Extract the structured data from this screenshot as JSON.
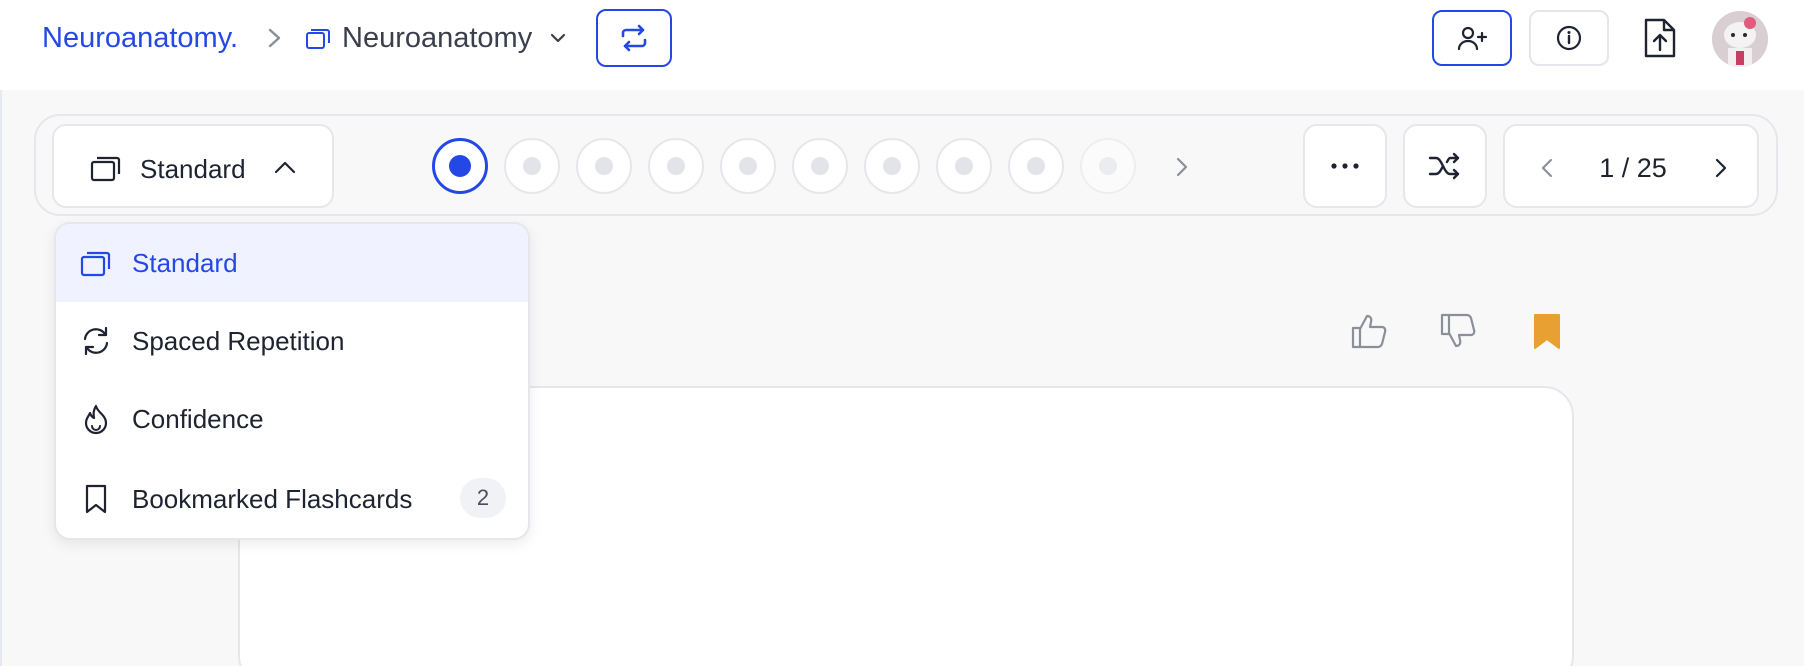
{
  "breadcrumb": {
    "root": "Neuroanatomy.",
    "deck": "Neuroanatomy"
  },
  "study_mode": {
    "selected": "Standard",
    "options": [
      {
        "label": "Standard",
        "icon": "cards-icon"
      },
      {
        "label": "Spaced Repetition",
        "icon": "refresh-icon"
      },
      {
        "label": "Confidence",
        "icon": "flame-icon"
      },
      {
        "label": "Bookmarked Flashcards",
        "icon": "bookmark-outline-icon",
        "badge": "2"
      }
    ]
  },
  "progress": {
    "current_index": 0,
    "visible_dots": 10
  },
  "pager": {
    "count": "1 / 25"
  },
  "colors": {
    "accent": "#2448e6",
    "bookmark": "#e8a033",
    "background": "#f8f8f9"
  }
}
